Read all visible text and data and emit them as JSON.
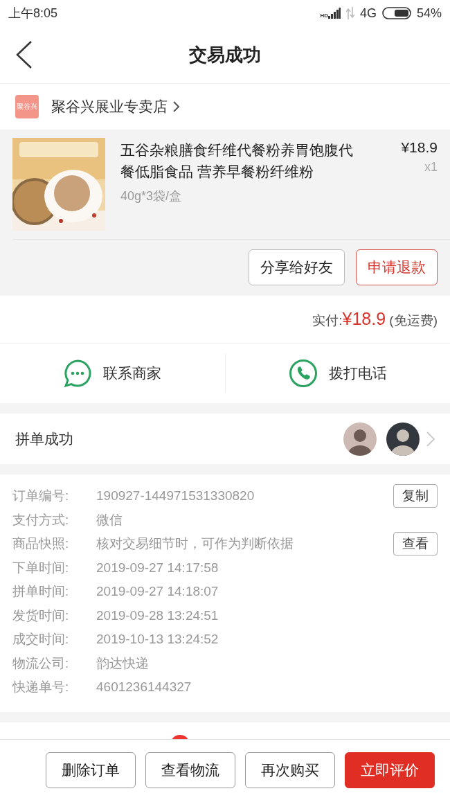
{
  "status_bar": {
    "time": "上午8:05",
    "signal_label": "HD",
    "network": "4G",
    "battery": "54%"
  },
  "header": {
    "title": "交易成功"
  },
  "store": {
    "logo": "聚谷兴",
    "name": "聚谷兴展业专卖店"
  },
  "product": {
    "title": "五谷杂粮膳食纤维代餐粉养胃饱腹代餐低脂食品 营养早餐粉纤维粉",
    "spec": "40g*3袋/盒",
    "price": "¥18.9",
    "quantity": "x1"
  },
  "item_buttons": [
    {
      "label": "分享给好友",
      "kind": "outline"
    },
    {
      "label": "申请退款",
      "kind": "danger"
    }
  ],
  "payment": {
    "label": "实付:",
    "amount": "¥18.9",
    "note": "(免运费)"
  },
  "contacts": [
    {
      "label": "联系商家",
      "kind": "chat"
    },
    {
      "label": "拨打电话",
      "kind": "phone"
    }
  ],
  "group": {
    "label": "拼单成功"
  },
  "details": [
    {
      "label": "订单编号:",
      "value": "190927-144971531330820",
      "action": "复制"
    },
    {
      "label": "支付方式:",
      "value": "微信"
    },
    {
      "label": "商品快照:",
      "value": "核对交易细节时，可作为判断依据",
      "action": "查看"
    },
    {
      "label": "下单时间:",
      "value": "2019-09-27 14:17:58"
    },
    {
      "label": "拼单时间:",
      "value": "2019-09-27 14:18:07"
    },
    {
      "label": "发货时间:",
      "value": "2019-09-28 13:24:51"
    },
    {
      "label": "成交时间:",
      "value": "2019-10-13 13:24:52"
    },
    {
      "label": "物流公司:",
      "value": "韵达快递"
    },
    {
      "label": "快递单号:",
      "value": "4601236144327"
    }
  ],
  "bottom_buttons": [
    {
      "label": "删除订单",
      "kind": "outline"
    },
    {
      "label": "查看物流",
      "kind": "outline"
    },
    {
      "label": "再次购买",
      "kind": "outline"
    },
    {
      "label": "立即评价",
      "kind": "primary"
    }
  ]
}
